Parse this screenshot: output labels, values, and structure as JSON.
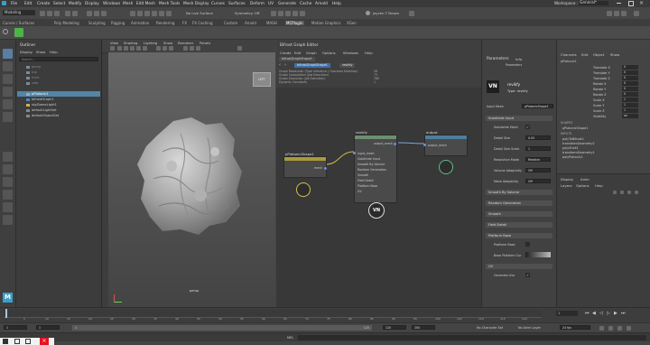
{
  "menubar": {
    "items": [
      "File",
      "Edit",
      "Create",
      "Select",
      "Modify",
      "Display",
      "Windows",
      "Mesh",
      "Edit Mesh",
      "Mesh Tools",
      "Mesh Display",
      "Curves",
      "Surfaces",
      "Deform",
      "UV",
      "Generate",
      "Cache",
      "Arnold",
      "Help"
    ],
    "workspace_label": "Workspace :",
    "workspace_value": "General*"
  },
  "statusbar": {
    "mode": "Modeling",
    "live_surface": "No Live Surface",
    "symmetry": "Symmetry: Off",
    "user": "Jaycen T Brown"
  },
  "shelf_tabs": [
    "Curves / Surfaces",
    "Poly Modeling",
    "Sculpting",
    "Rigging",
    "Animation",
    "Rendering",
    "FX",
    "FX Caching",
    "Custom",
    "Arnold",
    "MASH",
    "MCPlugin",
    "Motion Graphics",
    "XGen"
  ],
  "outliner": {
    "title": "Outliner",
    "menu": [
      "Display",
      "Show",
      "Help"
    ],
    "search_placeholder": "Search...",
    "items": [
      {
        "label": "persp",
        "selected": false,
        "dim": true
      },
      {
        "label": "top",
        "selected": false,
        "dim": true
      },
      {
        "label": "front",
        "selected": false,
        "dim": true
      },
      {
        "label": "side",
        "selected": false,
        "dim": true
      },
      {
        "label": "pPlatonic1",
        "selected": true,
        "dim": false
      },
      {
        "label": "bifrostGraph1",
        "selected": false,
        "dim": false
      },
      {
        "label": "skyDomeLight1",
        "selected": false,
        "dim": false
      },
      {
        "label": "defaultLightSet",
        "selected": false,
        "dim": false
      },
      {
        "label": "defaultObjectSet",
        "selected": false,
        "dim": false
      }
    ]
  },
  "viewport": {
    "menu": [
      "View",
      "Shading",
      "Lighting",
      "Show",
      "Renderer",
      "Panels"
    ],
    "camera_label": "persp",
    "axis_hint": "LEFT"
  },
  "graph_editor": {
    "window_title": "Bifrost Graph Editor",
    "menu": [
      "Create",
      "Edit",
      "Graph",
      "Options",
      "Windows",
      "Help"
    ],
    "tab": "bifrostGraphShape1",
    "breadcrumb": [
      "bifrostGraphShape1",
      "revikfy"
    ],
    "info_lines": [
      {
        "label": "Graph Resolution (Type Inference / Overload Selection)",
        "value": "28"
      },
      {
        "label": "Graph Compilation (Job Execution)",
        "value": "73"
      },
      {
        "label": "Graph Execution (Job Execution)",
        "value": "780"
      },
      {
        "label": "Dynamic Constants",
        "value": "1"
      }
    ],
    "nodes": {
      "input": {
        "title": "pPlatonicShape1",
        "port": "mesh"
      },
      "main": {
        "title": "revikfy",
        "ports_in": [
          "input_mesh",
          "Subdivide Input",
          "Smooth By Volume",
          "Random Generation",
          "Smooth",
          "Field Detail",
          "Platform Base",
          "UV"
        ],
        "port_out": "output_mesh"
      },
      "output": {
        "title": "output",
        "port": "output_mesh"
      }
    }
  },
  "parameters": {
    "title": "Parameters",
    "tab2": "Info",
    "subtitle": "Parameters",
    "logo_text": "revikfy",
    "type_label": "Type: revikfy",
    "input_mesh_label": "Input Mesh",
    "input_mesh_value": "pPlatonicShape1",
    "sections": {
      "subdivide_input": "Subdivide Input",
      "smooth_by_volume": "Smooth By Volume",
      "random_generation": "Random Generation",
      "smooth": "Smooth",
      "field_detail": "Field Detail",
      "platform_base": "Platform Base",
      "uv": "UV"
    },
    "subdivide_mesh_label": "Subdivide Mesh",
    "detail_size_label": "Detail Size",
    "detail_size_value": "0.05",
    "detail_size_scale_label": "Detail Size Scale",
    "detail_size_scale_value": "1",
    "resolution_mode_label": "Resolution Mode",
    "resolution_mode_value": "Relative",
    "volume_adaptivity_label": "Volume Adaptivity",
    "volume_adaptivity_value": "Off",
    "mesh_adaptivity_label": "Mesh Adaptivity",
    "mesh_adaptivity_value": "Off",
    "platform_base_label": "Platform Base",
    "base_platform_curve_label": "Base Platform Cur",
    "generate_uvs_label": "Generate Uvs"
  },
  "channel_box": {
    "menu": [
      "Channels",
      "Edit",
      "Object",
      "Show"
    ],
    "object": "pPlatonic1",
    "channels": [
      {
        "label": "Translate X",
        "value": "0"
      },
      {
        "label": "Translate Y",
        "value": "0"
      },
      {
        "label": "Translate Z",
        "value": "0"
      },
      {
        "label": "Rotate X",
        "value": "0"
      },
      {
        "label": "Rotate Y",
        "value": "0"
      },
      {
        "label": "Rotate Z",
        "value": "0"
      },
      {
        "label": "Scale X",
        "value": "1"
      },
      {
        "label": "Scale Y",
        "value": "1"
      },
      {
        "label": "Scale Z",
        "value": "1"
      },
      {
        "label": "Visibility",
        "value": "on"
      }
    ],
    "shapes_heading": "SHAPES",
    "shapes_value": "pPlatonicShape1",
    "inputs_heading": "INPUTS",
    "inputs": [
      "polyToBifrost1",
      "transformGeometry2",
      "polyShell1",
      "transformGeometry1",
      "polyPlatonic1"
    ],
    "layer_tabs": [
      "Display",
      "Anim"
    ],
    "layer_menu": [
      "Layers",
      "Options",
      "Help"
    ]
  },
  "timeline": {
    "ticks": [
      "5",
      "10",
      "15",
      "20",
      "25",
      "30",
      "35",
      "40",
      "45",
      "50",
      "55",
      "60",
      "65",
      "70",
      "75",
      "80",
      "85",
      "90",
      "95",
      "100",
      "105",
      "110",
      "115",
      "120"
    ],
    "current_frame": "1"
  },
  "range": {
    "start": "1",
    "start2": "1",
    "range_start": "1",
    "range_end": "120",
    "end": "120",
    "end2": "200",
    "character_set": "No Character Set",
    "anim_layer": "No Anim Layer",
    "fps": "24 fps"
  },
  "cmdline": {
    "label": "MEL"
  }
}
